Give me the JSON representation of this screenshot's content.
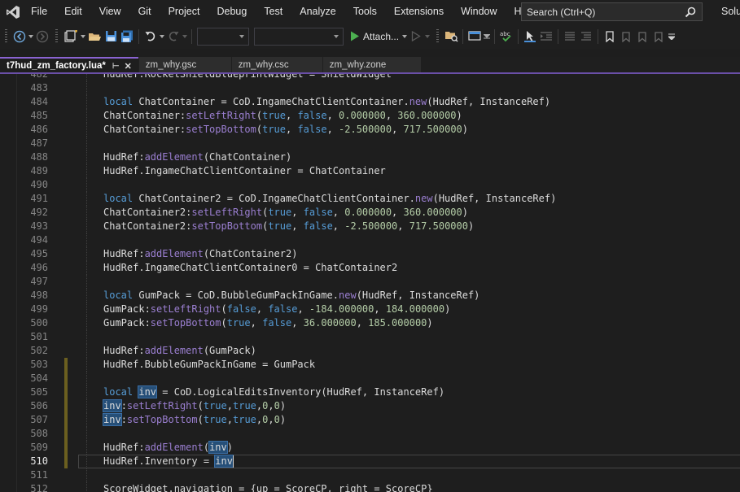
{
  "menubar": {
    "items": [
      "File",
      "Edit",
      "View",
      "Git",
      "Project",
      "Debug",
      "Test",
      "Analyze",
      "Tools",
      "Extensions",
      "Window",
      "Help"
    ],
    "search_placeholder": "Search (Ctrl+Q)",
    "solution_label": "Solu"
  },
  "toolbar": {
    "attach_label": "Attach...",
    "icons": [
      "back-icon",
      "forward-icon",
      "new-project-icon",
      "open-folder-icon",
      "save-icon",
      "save-all-icon",
      "undo-icon",
      "redo-icon",
      "start-icon",
      "start-without-debug-icon",
      "browse-icon",
      "screenshot-icon",
      "spellcheck-icon",
      "cursor-icon",
      "indent-icon",
      "comment-icon",
      "bookmark-icon"
    ]
  },
  "tabs": [
    {
      "label": "t7hud_zm_factory.lua*",
      "active": true
    },
    {
      "label": "zm_why.gsc",
      "active": false
    },
    {
      "label": "zm_why.csc",
      "active": false
    },
    {
      "label": "zm_why.zone",
      "active": false
    }
  ],
  "editor": {
    "current_line": "510",
    "lines": [
      {
        "n": "482",
        "t": "HudRef.RocketShieldBlueprintWidget = ShieldWidget"
      },
      {
        "n": "483",
        "t": ""
      },
      {
        "n": "484",
        "t": "local ChatContainer = CoD.IngameChatClientContainer.new(HudRef, InstanceRef)"
      },
      {
        "n": "485",
        "t": "ChatContainer:setLeftRight(true, false, 0.000000, 360.000000)"
      },
      {
        "n": "486",
        "t": "ChatContainer:setTopBottom(true, false, -2.500000, 717.500000)"
      },
      {
        "n": "487",
        "t": ""
      },
      {
        "n": "488",
        "t": "HudRef:addElement(ChatContainer)"
      },
      {
        "n": "489",
        "t": "HudRef.IngameChatClientContainer = ChatContainer"
      },
      {
        "n": "490",
        "t": ""
      },
      {
        "n": "491",
        "t": "local ChatContainer2 = CoD.IngameChatClientContainer.new(HudRef, InstanceRef)"
      },
      {
        "n": "492",
        "t": "ChatContainer2:setLeftRight(true, false, 0.000000, 360.000000)"
      },
      {
        "n": "493",
        "t": "ChatContainer2:setTopBottom(true, false, -2.500000, 717.500000)"
      },
      {
        "n": "494",
        "t": ""
      },
      {
        "n": "495",
        "t": "HudRef:addElement(ChatContainer2)"
      },
      {
        "n": "496",
        "t": "HudRef.IngameChatClientContainer0 = ChatContainer2"
      },
      {
        "n": "497",
        "t": ""
      },
      {
        "n": "498",
        "t": "local GumPack = CoD.BubbleGumPackInGame.new(HudRef, InstanceRef)"
      },
      {
        "n": "499",
        "t": "GumPack:setLeftRight(false, false, -184.000000, 184.000000)"
      },
      {
        "n": "500",
        "t": "GumPack:setTopBottom(true, false, 36.000000, 185.000000)"
      },
      {
        "n": "501",
        "t": ""
      },
      {
        "n": "502",
        "t": "HudRef:addElement(GumPack)"
      },
      {
        "n": "503",
        "t": "HudRef.BubbleGumPackInGame = GumPack"
      },
      {
        "n": "504",
        "t": ""
      },
      {
        "n": "505",
        "t": "local inv = CoD.LogicalEditsInventory(HudRef, InstanceRef)"
      },
      {
        "n": "506",
        "t": "inv:setLeftRight(true,true,0,0)"
      },
      {
        "n": "507",
        "t": "inv:setTopBottom(true,true,0,0)"
      },
      {
        "n": "508",
        "t": ""
      },
      {
        "n": "509",
        "t": "HudRef:addElement(inv)"
      },
      {
        "n": "510",
        "t": "HudRef.Inventory = inv"
      },
      {
        "n": "511",
        "t": ""
      },
      {
        "n": "512",
        "t": "ScoreWidget.navigation = {up = ScoreCP, right = ScoreCP}"
      }
    ]
  },
  "colors": {
    "keyword": "#569cd6",
    "method": "#9b7fd1",
    "number": "#b5cea8",
    "identifier": "#dcdcdc",
    "highlight": "#264f78",
    "tab_accent": "#8a63d2"
  }
}
